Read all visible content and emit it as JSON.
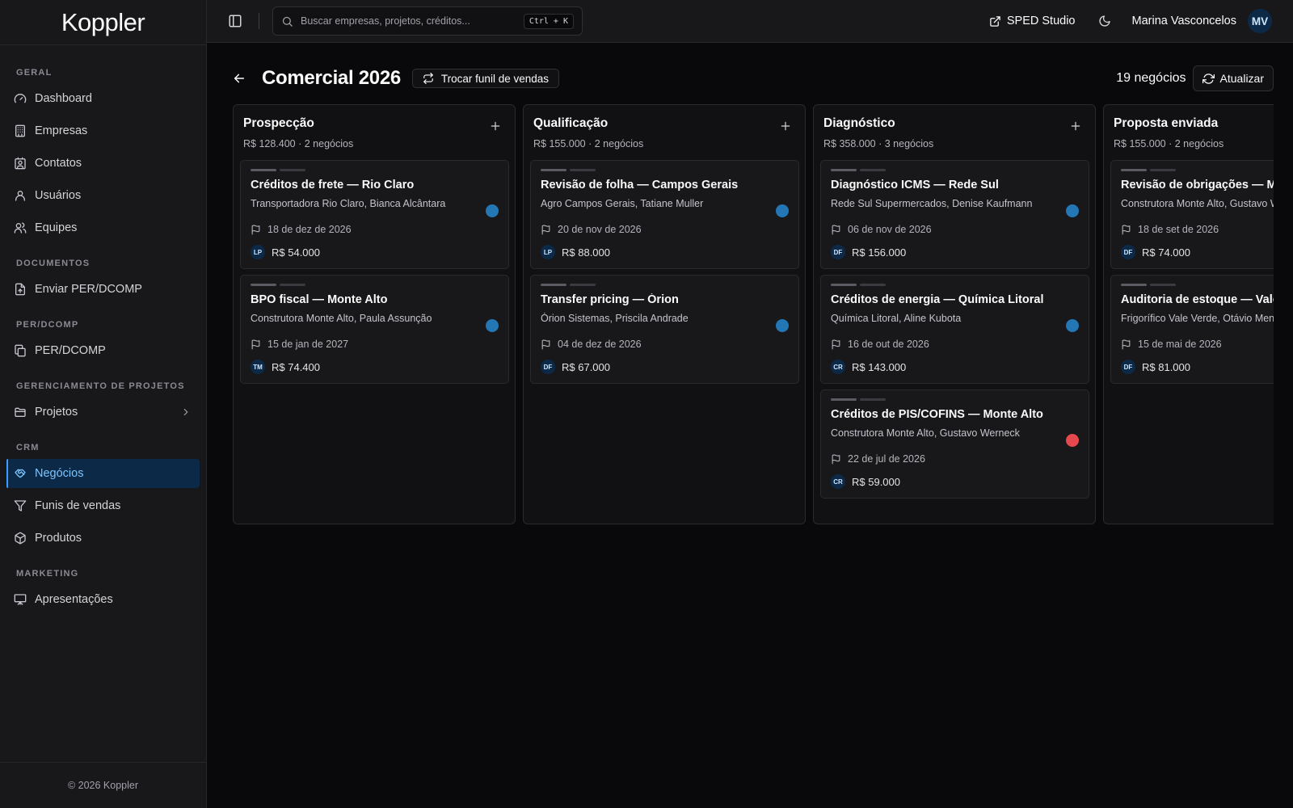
{
  "app": {
    "logo": "Koppler",
    "footer": "© 2026 Koppler"
  },
  "sidebar": {
    "groups": [
      {
        "label": "GERAL",
        "items": [
          {
            "label": "Dashboard",
            "icon": "gauge-icon"
          },
          {
            "label": "Empresas",
            "icon": "building-icon"
          },
          {
            "label": "Contatos",
            "icon": "contact-icon"
          },
          {
            "label": "Usuários",
            "icon": "user-icon"
          },
          {
            "label": "Equipes",
            "icon": "users-icon"
          }
        ]
      },
      {
        "label": "DOCUMENTOS",
        "items": [
          {
            "label": "Enviar PER/DCOMP",
            "icon": "file-upload-icon"
          }
        ]
      },
      {
        "label": "PER/DCOMP",
        "items": [
          {
            "label": "PER/DCOMP",
            "icon": "files-icon"
          }
        ]
      },
      {
        "label": "GERENCIAMENTO DE PROJETOS",
        "items": [
          {
            "label": "Projetos",
            "icon": "folder-icon"
          }
        ]
      },
      {
        "label": "CRM",
        "items": [
          {
            "label": "Negócios",
            "icon": "handshake-icon"
          },
          {
            "label": "Funis de vendas",
            "icon": "funnel-icon"
          },
          {
            "label": "Produtos",
            "icon": "package-icon"
          }
        ]
      },
      {
        "label": "MARKETING",
        "items": [
          {
            "label": "Apresentações",
            "icon": "presentation-icon"
          }
        ]
      }
    ],
    "active_item": "Negócios"
  },
  "topbar": {
    "search_placeholder": "Buscar empresas, projetos, créditos...",
    "shortcut": "Ctrl + K",
    "sped_label": "SPED Studio",
    "user_name": "Marina Vasconcelos",
    "user_initials": "MV"
  },
  "page": {
    "title": "Comercial 2026",
    "switch_label": "Trocar funil de vendas",
    "count_label": "19 negócios",
    "refresh_label": "Atualizar"
  },
  "colors": {
    "blue_dot": "#2377b5",
    "red_dot": "#e5484d",
    "accent": "#3b9eff"
  },
  "columns": [
    {
      "title": "Prospecção",
      "summary": "R$ 128.400 · 2 negócios",
      "cards": [
        {
          "title": "Créditos de frete — Rio Claro",
          "subtitle": "Transportadora Rio Claro, Bianca Alcântara",
          "date": "18 de dez de 2026",
          "initials": "LP",
          "amount": "R$ 54.000",
          "status": "blue"
        },
        {
          "title": "BPO fiscal — Monte Alto",
          "subtitle": "Construtora Monte Alto, Paula Assunção",
          "date": "15 de jan de 2027",
          "initials": "TM",
          "amount": "R$ 74.400",
          "status": "blue"
        }
      ]
    },
    {
      "title": "Qualificação",
      "summary": "R$ 155.000 · 2 negócios",
      "cards": [
        {
          "title": "Revisão de folha — Campos Gerais",
          "subtitle": "Agro Campos Gerais, Tatiane Muller",
          "date": "20 de nov de 2026",
          "initials": "LP",
          "amount": "R$ 88.000",
          "status": "blue"
        },
        {
          "title": "Transfer pricing — Órion",
          "subtitle": "Órion Sistemas, Priscila Andrade",
          "date": "04 de dez de 2026",
          "initials": "DF",
          "amount": "R$ 67.000",
          "status": "blue"
        }
      ]
    },
    {
      "title": "Diagnóstico",
      "summary": "R$ 358.000 · 3 negócios",
      "cards": [
        {
          "title": "Diagnóstico ICMS — Rede Sul",
          "subtitle": "Rede Sul Supermercados, Denise Kaufmann",
          "date": "06 de nov de 2026",
          "initials": "DF",
          "amount": "R$ 156.000",
          "status": "blue"
        },
        {
          "title": "Créditos de energia — Química Litoral",
          "subtitle": "Química Litoral, Aline Kubota",
          "date": "16 de out de 2026",
          "initials": "CR",
          "amount": "R$ 143.000",
          "status": "blue"
        },
        {
          "title": "Créditos de PIS/COFINS — Monte Alto",
          "subtitle": "Construtora Monte Alto, Gustavo Werneck",
          "date": "22 de jul de 2026",
          "initials": "CR",
          "amount": "R$ 59.000",
          "status": "red"
        }
      ]
    },
    {
      "title": "Proposta enviada",
      "summary": "R$ 155.000 · 2 negócios",
      "cards": [
        {
          "title": "Revisão de obrigações — Mo",
          "subtitle": "Construtora Monte Alto, Gustavo W",
          "date": "18 de set de 2026",
          "initials": "DF",
          "amount": "R$ 74.000",
          "status": "blue"
        },
        {
          "title": "Auditoria de estoque — Vale",
          "subtitle": "Frigorífico Vale Verde, Otávio Men",
          "date": "15 de mai de 2026",
          "initials": "DF",
          "amount": "R$ 81.000",
          "status": "blue"
        }
      ]
    }
  ]
}
